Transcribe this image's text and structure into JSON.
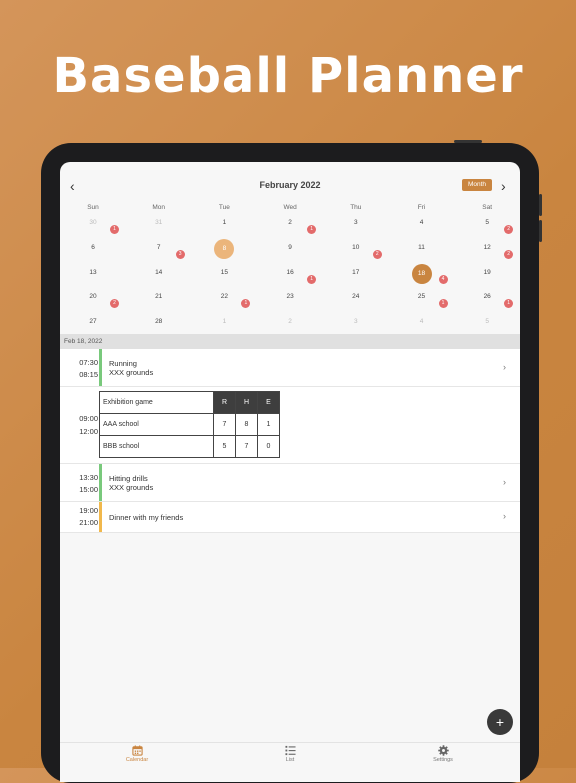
{
  "headline": "Baseball Planner",
  "calendar": {
    "title": "February 2022",
    "view_label": "Month",
    "prev_icon": "chevron-left-icon",
    "next_icon": "chevron-right-icon",
    "weekdays": [
      "Sun",
      "Mon",
      "Tue",
      "Wed",
      "Thu",
      "Fri",
      "Sat"
    ],
    "weeks": [
      [
        {
          "d": "30",
          "o": true,
          "b": "1"
        },
        {
          "d": "31",
          "o": true
        },
        {
          "d": "1"
        },
        {
          "d": "2",
          "b": "1"
        },
        {
          "d": "3"
        },
        {
          "d": "4"
        },
        {
          "d": "5",
          "b": "2"
        }
      ],
      [
        {
          "d": "6"
        },
        {
          "d": "7",
          "b": "3"
        },
        {
          "d": "8",
          "s": "selected"
        },
        {
          "d": "9"
        },
        {
          "d": "10",
          "b": "2"
        },
        {
          "d": "11"
        },
        {
          "d": "12",
          "b": "2"
        }
      ],
      [
        {
          "d": "13"
        },
        {
          "d": "14"
        },
        {
          "d": "15"
        },
        {
          "d": "16",
          "b": "1"
        },
        {
          "d": "17"
        },
        {
          "d": "18",
          "s": "today",
          "b": "4"
        },
        {
          "d": "19"
        }
      ],
      [
        {
          "d": "20",
          "b": "2"
        },
        {
          "d": "21"
        },
        {
          "d": "22",
          "b": "1"
        },
        {
          "d": "23"
        },
        {
          "d": "24"
        },
        {
          "d": "25",
          "b": "1"
        },
        {
          "d": "26",
          "b": "1"
        }
      ],
      [
        {
          "d": "27"
        },
        {
          "d": "28"
        },
        {
          "d": "1",
          "o": true
        },
        {
          "d": "2",
          "o": true
        },
        {
          "d": "3",
          "o": true
        },
        {
          "d": "4",
          "o": true
        },
        {
          "d": "5",
          "o": true
        }
      ]
    ]
  },
  "selected_date": "Feb 18, 2022",
  "events": {
    "e1": {
      "start": "07:30",
      "end": "08:15",
      "title": "Running",
      "location": "XXX grounds",
      "color": "#79c97c"
    },
    "game": {
      "start": "09:00",
      "end": "12:00",
      "title": "Exhibition game",
      "headers": [
        "R",
        "H",
        "E"
      ],
      "teams": [
        {
          "name": "AAA school",
          "r": "7",
          "h": "8",
          "e": "1"
        },
        {
          "name": "BBB school",
          "r": "5",
          "h": "7",
          "e": "0"
        }
      ]
    },
    "e3": {
      "start": "13:30",
      "end": "15:00",
      "title": "Hitting drills",
      "location": "XXX grounds",
      "color": "#79c97c"
    },
    "e4": {
      "start": "19:00",
      "end": "21:00",
      "title": "Dinner with my friends",
      "color": "#f1b84c"
    }
  },
  "fab_icon": "plus-icon",
  "tabs": {
    "calendar": {
      "label": "Calendar",
      "icon": "calendar-icon"
    },
    "list": {
      "label": "List",
      "icon": "list-icon"
    },
    "settings": {
      "label": "Settings",
      "icon": "gear-icon"
    }
  },
  "colors": {
    "accent": "#c98540",
    "badge": "#e36b6b",
    "selected": "#ebb57b"
  }
}
